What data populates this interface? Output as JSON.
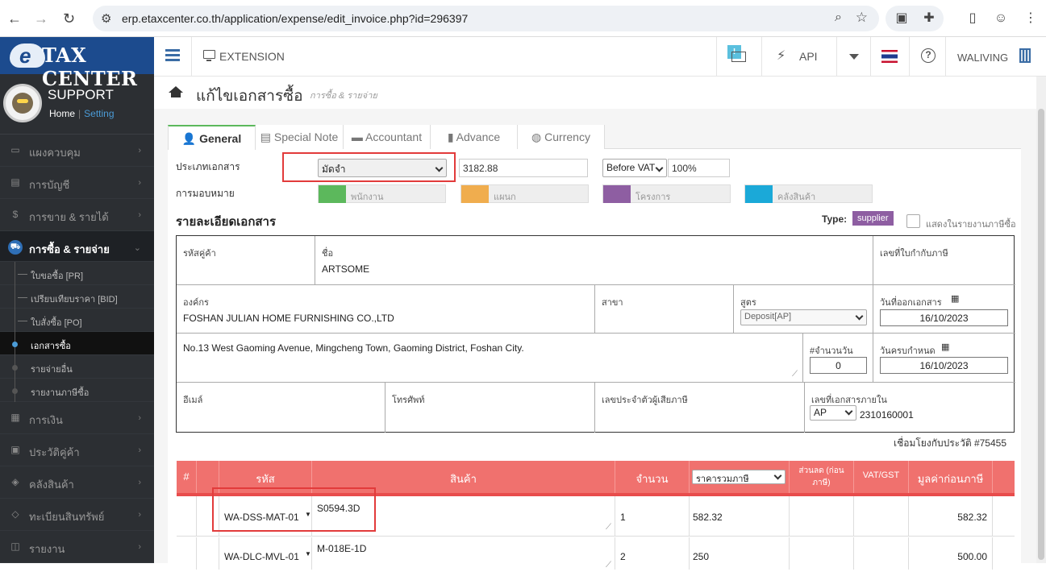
{
  "browser": {
    "url": "erp.etaxcenter.co.th/application/expense/edit_invoice.php?id=296397"
  },
  "sidebar": {
    "logo": "TAX CENTER",
    "logo_e": "e",
    "profile": {
      "name": "SUPPORT",
      "home": "Home",
      "setting": "Setting"
    },
    "items": [
      {
        "label": "แผงควบคุม"
      },
      {
        "label": "การบัญชี"
      },
      {
        "label": "การขาย & รายได้"
      },
      {
        "label": "การซื้อ & รายจ่าย"
      },
      {
        "label": "การเงิน"
      },
      {
        "label": "ประวัติคู่ค้า"
      },
      {
        "label": "คลังสินค้า"
      },
      {
        "label": "ทะเบียนสินทรัพย์"
      },
      {
        "label": "รายงาน"
      }
    ],
    "submenu": [
      {
        "label": "ใบขอซื้อ [PR]"
      },
      {
        "label": "เปรียบเทียบราคา [BID]"
      },
      {
        "label": "ใบสั่งซื้อ [PO]"
      },
      {
        "label": "เอกสารซื้อ"
      },
      {
        "label": "รายจ่ายอื่น"
      },
      {
        "label": "รายงานภาษีซื้อ"
      }
    ]
  },
  "topbar": {
    "extension": "EXTENSION",
    "notif": "!",
    "api": "API",
    "user": "WALIVING"
  },
  "page": {
    "title": "แก้ไขเอกสารซื้อ",
    "subtitle": "การซื้อ & รายจ่าย"
  },
  "tabs": [
    {
      "label": "General"
    },
    {
      "label": "Special Note"
    },
    {
      "label": "Accountant"
    },
    {
      "label": "Advance"
    },
    {
      "label": "Currency"
    }
  ],
  "form": {
    "doc_type_label": "ประเภทเอกสาร",
    "doc_type_value": "มัดจำ",
    "amount": "3182.88",
    "vat_mode": "Before VAT",
    "vat_rate": "100%",
    "assign_label": "การมอบหมาย",
    "assign": [
      {
        "label": "พนักงาน",
        "color": "#5cb85c"
      },
      {
        "label": "แผนก",
        "color": "#f0ad4e"
      },
      {
        "label": "โครงการ",
        "color": "#8e5ea2"
      },
      {
        "label": "คลังสินค้า",
        "color": "#1ba9d8"
      }
    ]
  },
  "details": {
    "title": "รายละเอียดเอกสาร",
    "type_label": "Type:",
    "type_value": "supplier",
    "show_in_report": "แสดงในรายงานภาษีซื้อ",
    "supplier_code_label": "รหัสคู่ค้า",
    "name_label": "ชื่อ",
    "name_value": "ARTSOME",
    "tax_id_label": "เลขที่ใบกำกับภาษี",
    "org_label": "องค์กร",
    "org_value": "FOSHAN JULIAN HOME FURNISHING CO.,LTD",
    "branch_label": "สาขา",
    "formula_label": "สูตร",
    "formula_value": "Deposit[AP]",
    "issue_date_label": "วันที่ออกเอกสาร",
    "issue_date": "16/10/2023",
    "address": "No.13 West Gaoming Avenue, Mingcheng Town, Gaoming District, Foshan City.",
    "days_label": "#จำนวนวัน",
    "days": "0",
    "due_label": "วันครบกำหนด",
    "due_date": "16/10/2023",
    "email_label": "อีเมล์",
    "phone_label": "โทรศัพท์",
    "taxpayer_label": "เลขประจำตัวผู้เสียภาษี",
    "internal_no_label": "เลขที่เอกสารภายใน",
    "internal_prefix": "AP",
    "internal_no": "2310160001",
    "link_text": "เชื่อมโยงกับประวัติ #75455"
  },
  "items": {
    "headers": {
      "hash": "#",
      "code": "รหัส",
      "product": "สินค้า",
      "qty": "จำนวน",
      "price_mode": "ราคารวมภาษี",
      "discount": "ส่วนลด (ก่อนภาษี)",
      "vat": "VAT/GST",
      "value": "มูลค่าก่อนภาษี"
    },
    "rows": [
      {
        "code": "WA-DSS-MAT-01",
        "product": "S0594.3D",
        "qty": "1",
        "price": "582.32",
        "value": "582.32"
      },
      {
        "code": "WA-DLC-MVL-01",
        "product": "M-018E-1D",
        "qty": "2",
        "price": "250",
        "value": "500.00"
      }
    ]
  }
}
